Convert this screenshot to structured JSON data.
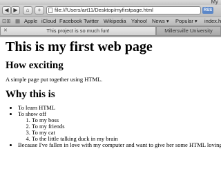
{
  "browser": {
    "window_title": "My",
    "address_url": "file:///Users/art11/Desktop/myfirstpage.html",
    "rss_label": "RSS",
    "bookmarks": [
      "Apple",
      "iCloud",
      "Facebook",
      "Twitter",
      "Wikipedia",
      "Yahoo!",
      "News ▾",
      "Popular ▾",
      "index.h"
    ],
    "tabs": [
      {
        "label": "This project is so much fun!",
        "active": true
      },
      {
        "label": "Millersville University",
        "active": false
      }
    ]
  },
  "page": {
    "h1": "This is my first web page",
    "h2_1": "How exciting",
    "intro": "A simple page put together using HTML.",
    "h2_2": "Why this is",
    "list": {
      "item1": "To learn HTML",
      "item2": "To show off",
      "sub": [
        "To my boss",
        "To my friends",
        "To my cat",
        "To the little talking duck in my brain"
      ],
      "item3": "Because I've fallen in love with my computer and want to give her some HTML loving."
    }
  }
}
